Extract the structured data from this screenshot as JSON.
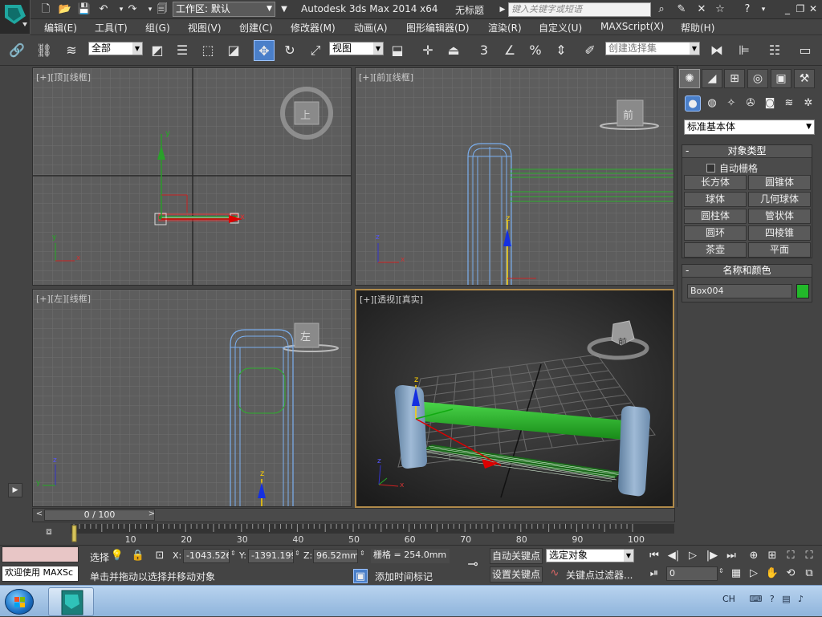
{
  "titlebar": {
    "workspace_label": "工作区: 默认",
    "app_title": "Autodesk 3ds Max  2014 x64",
    "doc_title": "无标题",
    "search_placeholder": "键入关键字或短语"
  },
  "menu": [
    "编辑(E)",
    "工具(T)",
    "组(G)",
    "视图(V)",
    "创建(C)",
    "修改器(M)",
    "动画(A)",
    "图形编辑器(D)",
    "渲染(R)",
    "自定义(U)",
    "MAXScript(X)",
    "帮助(H)"
  ],
  "toolbar": {
    "selection_filter": "全部",
    "ref_coord": "视图",
    "named_selection_placeholder": "创建选择集",
    "snap_label": "3"
  },
  "viewports": {
    "top": {
      "plus": "[+]",
      "name": "[顶]",
      "shade": "[线框]",
      "cube_label": "上"
    },
    "front": {
      "plus": "[+]",
      "name": "[前]",
      "shade": "[线框]",
      "cube_label": "前"
    },
    "left": {
      "plus": "[+]",
      "name": "[左]",
      "shade": "[线框]",
      "cube_label": "左"
    },
    "perspective": {
      "plus": "[+]",
      "name": "[透视]",
      "shade": "[真实]",
      "cube_label": "前"
    }
  },
  "axis_labels": {
    "x": "x",
    "y": "y",
    "z": "z"
  },
  "command_panel": {
    "primitive_type": "标准基本体",
    "object_type_title": "对象类型",
    "autogrid_label": "自动栅格",
    "buttons": [
      "长方体",
      "圆锥体",
      "球体",
      "几何球体",
      "圆柱体",
      "管状体",
      "圆环",
      "四棱锥",
      "茶壶",
      "平面"
    ],
    "name_color_title": "名称和颜色",
    "object_name": "Box004",
    "object_color": "#22b82a"
  },
  "timeline": {
    "frame_display": "0 / 100",
    "ticks": [
      "10",
      "20",
      "30",
      "40",
      "50",
      "60",
      "70",
      "80",
      "90",
      "100"
    ]
  },
  "statusbar": {
    "script_listener": "欢迎使用 MAXSc",
    "select_label": "选择",
    "x_label": "X:",
    "x_value": "-1043.526",
    "y_label": "Y:",
    "y_value": "-1391.199",
    "z_label": "Z:",
    "z_value": "96.52mm",
    "grid_label": "栅格 = 254.0mm",
    "prompt": "单击并拖动以选择并移动对象",
    "add_time_tag": "添加时间标记",
    "auto_key": "自动关键点",
    "set_key": "设置关键点",
    "key_mode": "选定对象",
    "key_filters": "关键点过滤器...",
    "current_frame": "0"
  },
  "taskbar": {
    "tray_lang": "CH"
  }
}
